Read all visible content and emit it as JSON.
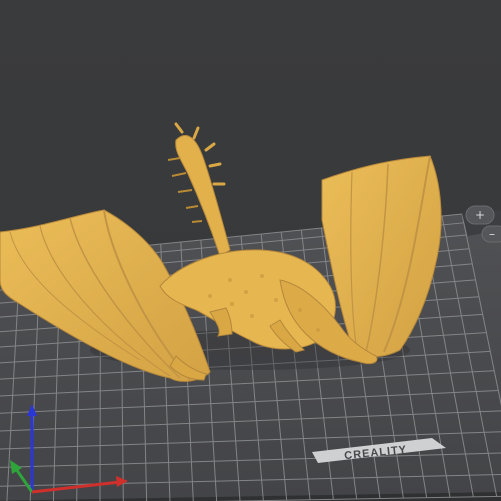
{
  "viewport": {
    "background_color": "#38393b",
    "bed": {
      "brand_logo": "CREALITY",
      "grid_color": "#8a8b8d",
      "surface_color": "#47484b"
    },
    "model": {
      "name": "dragon-model",
      "color": "#e5b54f",
      "shade_color": "#b98a34"
    },
    "axis_gizmo": {
      "x_color": "#d0302c",
      "y_color": "#2fa43a",
      "z_color": "#2b36d6"
    },
    "side_controls": {
      "zoom_in_icon": "plus-icon",
      "zoom_out_icon": "minus-icon"
    }
  }
}
